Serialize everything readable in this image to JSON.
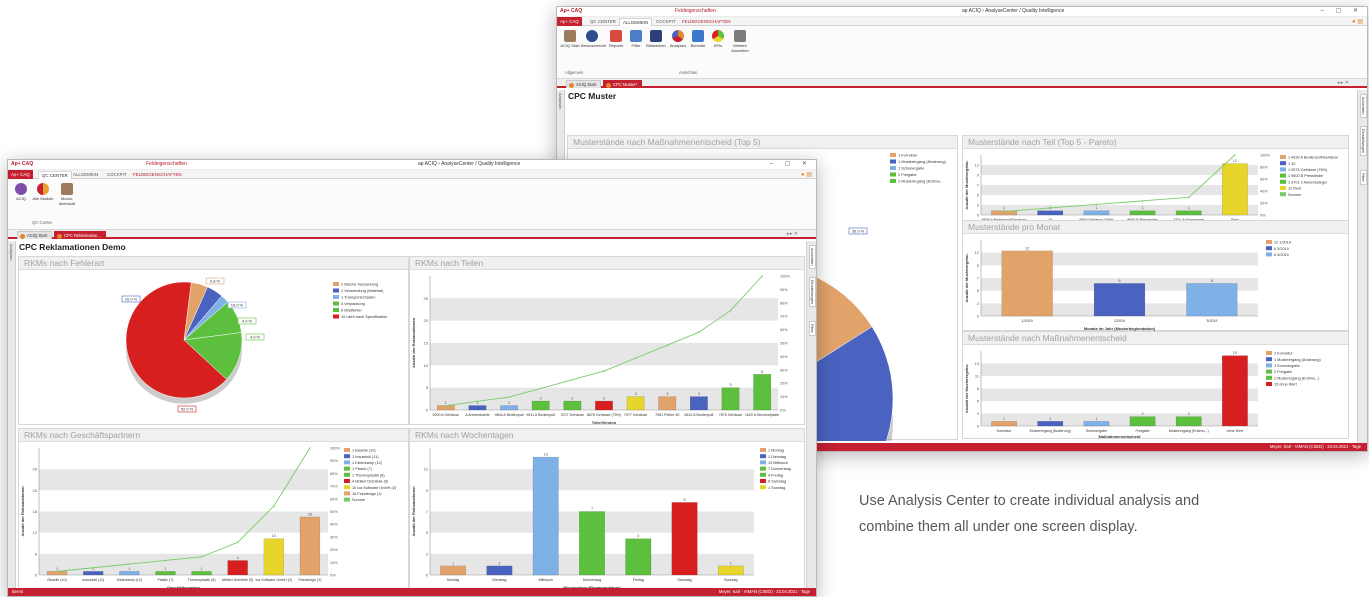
{
  "caption": {
    "line1": "Use Analysis Center to create individual analysis and",
    "line2": "combine them all under one screen display."
  },
  "colors": {
    "brand_red": "#c4202f",
    "orange": "#e0892c",
    "series_tan": "#e2a36b",
    "series_blue": "#4a63c0",
    "series_lightblue": "#7fb0e6",
    "series_green": "#5cbf3e",
    "series_yellow": "#e8d52b",
    "series_red": "#d81f1f",
    "pareto_line": "#7acb6a"
  },
  "back_window": {
    "app_name": "Ap+ CAQ",
    "context_title": "Feldeigenschaften",
    "title": "ap ACIQ › AnalyseCenter / Quality Intelligence",
    "tabs": [
      "Ap+ CAQ",
      "QC CENTER",
      "ALLGEMEIN",
      "COCKPIT",
      "FELDEIGENSCHAFTEN"
    ],
    "active_tab": 2,
    "ribbon_buttons": [
      "ACIQ Start",
      "Benutzerrecht",
      "Reports",
      "Filter",
      "Bildwerken",
      "Analysen",
      "Berichte",
      "KPIs",
      "Weitere Ansichten"
    ],
    "ribbon_groups": [
      "Allgemein",
      "Ansichten"
    ],
    "doc_tabs": [
      "ACIQ Start",
      "CPC Muster*"
    ],
    "page_title": "CPC Muster",
    "left_strip": "Analysen",
    "right_strip": [
      "Ansichten",
      "Einstellungen",
      "Filter"
    ],
    "status_right": "Meyer, Karl · VIMAN (CSED) · 23.04.2021 · Tage"
  },
  "front_window": {
    "app_name": "Ap+ CAQ",
    "context_title": "Feldeigenschaften",
    "title": "ap ACIQ › AnalyseCenter / Quality Intelligence",
    "tabs": [
      "Ap+ CAQ",
      "QC CENTER",
      "ALLGEMEIN",
      "COCKPIT",
      "FELDEIGENSCHAFTEN"
    ],
    "active_tab": 1,
    "ribbon_buttons": [
      "ACIQ",
      "Alle Module",
      "Modul-übersicht"
    ],
    "ribbon_group": "QC-Center",
    "doc_tabs": [
      "ACIQ Start",
      "CPC Reklamation..."
    ],
    "page_title": "CPC Reklamationen Demo",
    "left_strip": "Analysen",
    "right_strip": [
      "Ansichten",
      "Einstellungen",
      "Filter"
    ],
    "status_left": "Bereit",
    "status_right": "Meyer, Karl · VIMAN (CSED) · 23.04.2021 · Tage"
  },
  "chart_data": [
    {
      "id": "back_p1",
      "type": "pie",
      "title": "Musterstände nach Maßnahmenentscheid (Top 5)",
      "legend": [
        "1 Korrektur",
        "1 Musterergang (Änderung)",
        "1 Schonergabe",
        "2 Freigabe",
        "2 Musterergang (Erstmu..."
      ],
      "data_labels": [
        "28.0 %",
        "36.0 %"
      ]
    },
    {
      "id": "back_p2",
      "type": "bar",
      "title": "Musterstände nach Teil (Top 5 - Pareto)",
      "ylabel": "Anzahl der Musterergebn.",
      "xlabel": "Teil",
      "categories": [
        "9600 A Bedienpult/Gehäuse",
        "10",
        "9500 Gehäuse (75%)",
        "9600 B Pressfelder",
        "3701 Außenspiegel",
        "Rest"
      ],
      "values": [
        1,
        1,
        1,
        1,
        1,
        12
      ],
      "ylim": [
        0,
        14
      ],
      "y2ticks": [
        "0%",
        "20%",
        "40%",
        "60%",
        "80%",
        "100%"
      ],
      "legend": [
        "1 4639 A Bedienpult/Gehäuse",
        "1 10",
        "1 9575 Gehäuse (75%)",
        "1 9600 B Pressfelder",
        "1 3701 2 Außenspiegel",
        "12 Rest",
        "Summe"
      ]
    },
    {
      "id": "back_p3",
      "type": "bar",
      "title": "Musterstände pro Monat",
      "ylabel": "Anzahl der Musterergebn.",
      "xlabel": "Monate im Jahr (Musterbeginndatum)",
      "categories": [
        "1/2019",
        "2/2019",
        "3/2019"
      ],
      "values": [
        12,
        6,
        6
      ],
      "ylim": [
        0,
        14
      ],
      "legend": [
        "12 1/2019",
        "6 2/2019",
        "6 3/2019"
      ]
    },
    {
      "id": "back_p4",
      "type": "bar",
      "title": "Musterstände nach Maßnahmenentscheid",
      "ylabel": "Anzahl der Musterergebn.",
      "xlabel": "Maßnahmenentscheid",
      "categories": [
        "Korrektur",
        "Musterergang (Änderung)",
        "Schonergabe",
        "Freigabe",
        "Musterergang (Erstmu...)",
        "ohne Wert"
      ],
      "values": [
        1,
        1,
        1,
        2,
        2,
        15
      ],
      "ylim": [
        0,
        16
      ],
      "legend": [
        "1 Korrektur",
        "1 Musterergang (Änderung)",
        "1 Schonergabe",
        "2 Freigabe",
        "2 Musterergang (Erstmu...)",
        "15 ohne Wert"
      ]
    },
    {
      "id": "front_p1",
      "type": "pie",
      "title": "RKMs nach Fehlerart",
      "legend": [
        "2 falsche Verpackung",
        "2 Verwendung (Material)",
        "1 Transportschaden",
        "4 Verpackung",
        "6 Maßfehler",
        "10 nicht nach Spezifikation"
      ],
      "values": [
        2,
        2,
        1,
        4,
        6,
        28
      ],
      "data_labels": [
        "9.8 %",
        "16.0 %",
        "16.0 %",
        "4.0 %",
        "4.0 %",
        "52.0 %"
      ]
    },
    {
      "id": "front_p2",
      "type": "bar",
      "title": "RKMs nach Teilen",
      "ylabel": "Anzahl der Reklamationen",
      "xlabel": "Teile/Version",
      "categories": [
        "9200 A Gehäuse",
        "A Antriebswelle",
        "9604 A Bedienpult",
        "9611 A Bedienpult",
        "3707 Gehäuse",
        "8876 Gehäuse (75%)",
        "7977 Gehäuse",
        "7981 Pfeiler 30",
        "5610 A Bedienpult",
        "7876 Gehäuse",
        "1620 A Wechselplatte"
      ],
      "values": [
        1,
        1,
        1,
        2,
        2,
        2,
        3,
        3,
        3,
        5,
        8
      ],
      "ylim": [
        0,
        30
      ],
      "y2ticks": [
        "0%",
        "10%",
        "20%",
        "30%",
        "40%",
        "50%",
        "60%",
        "70%",
        "80%",
        "90%",
        "100%"
      ]
    },
    {
      "id": "front_p3",
      "type": "bar",
      "title": "RKMs nach Geschäftspartnern",
      "ylabel": "Anzahl der Reklamationen",
      "xlabel": "Geschäftspartner",
      "categories": [
        "Bauelle (10)",
        "Inauwinkl (11)",
        "Kilderkamp (12)",
        "Plastic (7)",
        "Thermoplastik (8)",
        "Müllerl Drehteile (9)",
        "Ica Software GmbH (2)",
        "Feindesign (1)"
      ],
      "values": [
        1,
        1,
        1,
        1,
        1,
        4,
        10,
        16
      ],
      "ylim": [
        0,
        35
      ],
      "legend": [
        "1 Bauelle (10)",
        "1 Inauwinkl (11)",
        "1 Kilderkamp (12)",
        "1 Plastic (7)",
        "1 Thermoplastik (8)",
        "4 Müllerl Drehteile (9)",
        "10 Ica Software GmbH (2)",
        "16 Feindesign (1)",
        "Summe"
      ],
      "y2ticks": [
        "0%",
        "10%",
        "20%",
        "30%",
        "40%",
        "50%",
        "60%",
        "70%",
        "80%",
        "90%",
        "100%"
      ]
    },
    {
      "id": "front_p4",
      "type": "bar",
      "title": "RKMs nach Wochentagen",
      "ylabel": "Anzahl der Reklamationen",
      "xlabel": "Wochentage (Eingangsdatum)",
      "categories": [
        "Montag",
        "Dienstag",
        "Mittwoch",
        "Donnerstag",
        "Freitag",
        "Samstag",
        "Sonntag"
      ],
      "values": [
        1,
        1,
        13,
        7,
        4,
        8,
        1
      ],
      "ylim": [
        0,
        14
      ],
      "legend": [
        "1 Montag",
        "1 Dienstag",
        "13 Mittwoch",
        "7 Donnerstag",
        "4 Freitag",
        "8 Samstag",
        "1 Sonntag"
      ]
    }
  ]
}
